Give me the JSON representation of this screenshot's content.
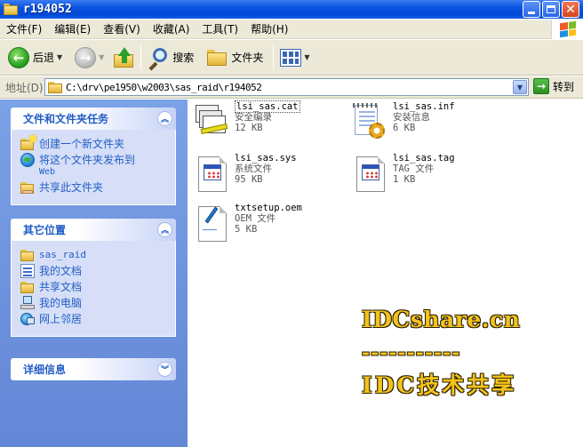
{
  "window": {
    "title": "r194052"
  },
  "menu": [
    {
      "label": "文件(F)"
    },
    {
      "label": "编辑(E)"
    },
    {
      "label": "查看(V)"
    },
    {
      "label": "收藏(A)"
    },
    {
      "label": "工具(T)"
    },
    {
      "label": "帮助(H)"
    }
  ],
  "toolbar": {
    "back_label": "后退",
    "search_label": "搜索",
    "folders_label": "文件夹"
  },
  "address": {
    "label": "地址(D)",
    "path": "C:\\drv\\pe1950\\w2003\\sas_raid\\r194052",
    "go_label": "转到"
  },
  "tasks_panel": {
    "title": "文件和文件夹任务",
    "items": [
      {
        "label": "创建一个新文件夹"
      },
      {
        "label": "将这个文件夹发布到",
        "sub": "Web"
      },
      {
        "label": "共享此文件夹"
      }
    ]
  },
  "places_panel": {
    "title": "其它位置",
    "items": [
      {
        "label": "sas_raid"
      },
      {
        "label": "我的文档"
      },
      {
        "label": "共享文档"
      },
      {
        "label": "我的电脑"
      },
      {
        "label": "网上邻居"
      }
    ]
  },
  "details_panel": {
    "title": "详细信息"
  },
  "files": [
    {
      "name": "lsi_sas.cat",
      "type": "安全编录",
      "size": "12 KB"
    },
    {
      "name": "lsi_sas.inf",
      "type": "安装信息",
      "size": "6 KB"
    },
    {
      "name": "lsi_sas.sys",
      "type": "系统文件",
      "size": "95 KB"
    },
    {
      "name": "lsi_sas.tag",
      "type": "TAG 文件",
      "size": "1 KB"
    },
    {
      "name": "txtsetup.oem",
      "type": "OEM 文件",
      "size": "5 KB"
    }
  ],
  "watermark": {
    "line1": "IDCshare.cn",
    "line2": "-----------",
    "line3": "IDC技术共享"
  },
  "colors": {
    "titlebar": "#0a55e0",
    "task_pane": "#6c91dc",
    "task_link": "#215dc6",
    "watermark": "#f3c21c"
  }
}
